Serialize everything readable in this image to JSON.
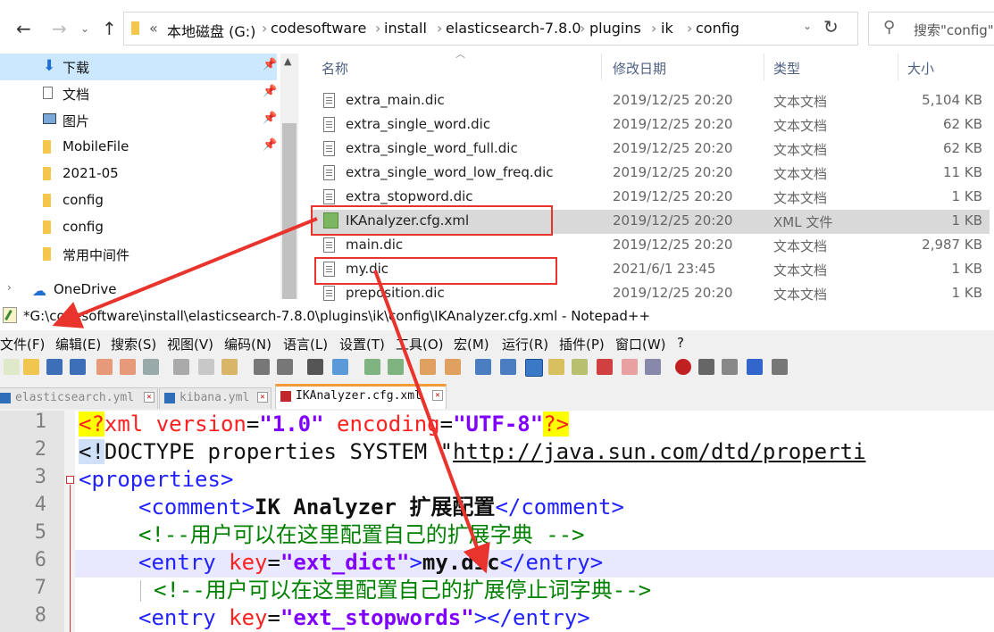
{
  "explorer": {
    "breadcrumb": [
      "«",
      "本地磁盘 (G:)",
      "codesoftware",
      "install",
      "elasticsearch-7.8.0",
      "plugins",
      "ik",
      "config"
    ],
    "search_placeholder": "搜索\"config\"",
    "sidebar": [
      {
        "label": "下载",
        "icon": "download-icon",
        "pinned": true
      },
      {
        "label": "文档",
        "icon": "document-icon",
        "pinned": true
      },
      {
        "label": "图片",
        "icon": "picture-icon",
        "pinned": true
      },
      {
        "label": "MobileFile",
        "icon": "folder-icon",
        "pinned": true
      },
      {
        "label": "2021-05",
        "icon": "folder-icon",
        "pinned": false
      },
      {
        "label": "config",
        "icon": "folder-icon",
        "pinned": false
      },
      {
        "label": "config",
        "icon": "folder-icon",
        "pinned": false
      },
      {
        "label": "常用中间件",
        "icon": "folder-icon",
        "pinned": false
      },
      {
        "label": "OneDrive",
        "icon": "cloud-icon",
        "pinned": false
      }
    ],
    "columns": {
      "name": "名称",
      "date": "修改日期",
      "type": "类型",
      "size": "大小"
    },
    "files": [
      {
        "name": "extra_main.dic",
        "date": "2019/12/25 20:20",
        "type": "文本文档",
        "size": "5,104 KB"
      },
      {
        "name": "extra_single_word.dic",
        "date": "2019/12/25 20:20",
        "type": "文本文档",
        "size": "62 KB"
      },
      {
        "name": "extra_single_word_full.dic",
        "date": "2019/12/25 20:20",
        "type": "文本文档",
        "size": "62 KB"
      },
      {
        "name": "extra_single_word_low_freq.dic",
        "date": "2019/12/25 20:20",
        "type": "文本文档",
        "size": "11 KB"
      },
      {
        "name": "extra_stopword.dic",
        "date": "2019/12/25 20:20",
        "type": "文本文档",
        "size": "1 KB"
      },
      {
        "name": "IKAnalyzer.cfg.xml",
        "date": "2019/12/25 20:20",
        "type": "XML 文件",
        "size": "1 KB"
      },
      {
        "name": "main.dic",
        "date": "2019/12/25 20:20",
        "type": "文本文档",
        "size": "2,987 KB"
      },
      {
        "name": "my.dic",
        "date": "2021/6/1 23:45",
        "type": "文本文档",
        "size": "1 KB"
      },
      {
        "name": "preposition.dic",
        "date": "2019/12/25 20:20",
        "type": "文本文档",
        "size": "1 KB"
      }
    ]
  },
  "npp": {
    "title": "*G:\\codesoftware\\install\\elasticsearch-7.8.0\\plugins\\ik\\config\\IKAnalyzer.cfg.xml - Notepad++",
    "menu": [
      "文件(F)",
      "编辑(E)",
      "搜索(S)",
      "视图(V)",
      "编码(N)",
      "语言(L)",
      "设置(T)",
      "工具(O)",
      "宏(M)",
      "运行(R)",
      "插件(P)",
      "窗口(W)",
      "?"
    ],
    "tabs": [
      "elasticsearch.yml",
      "kibana.yml",
      "IKAnalyzer.cfg.xml"
    ],
    "line_numbers": [
      "1",
      "2",
      "3",
      "4",
      "5",
      "6",
      "7",
      "8"
    ],
    "code": {
      "l1": [
        "<?",
        "xml",
        " version",
        "=",
        "\"1.0\"",
        " encoding",
        "=",
        "\"UTF-8\"",
        "?>"
      ],
      "l2": [
        "<!",
        "DOCTYPE properties SYSTEM \"",
        "http://java.sun.com/dtd/properti"
      ],
      "l3": [
        "<properties>"
      ],
      "l4": [
        "<comment>",
        "IK Analyzer 扩展配置",
        "</comment>"
      ],
      "l5": [
        "<!--用户可以在这里配置自己的扩展字典 -->"
      ],
      "l6": [
        "<entry",
        " key",
        "=",
        "\"ext_dict\"",
        ">",
        "my.dic",
        "</entry>"
      ],
      "l7": [
        "<!--用户可以在这里配置自己的扩展停止词字典-->"
      ],
      "l8": [
        "<entry",
        " key",
        "=",
        "\"ext_stopwords\"",
        "></entry>"
      ]
    }
  }
}
